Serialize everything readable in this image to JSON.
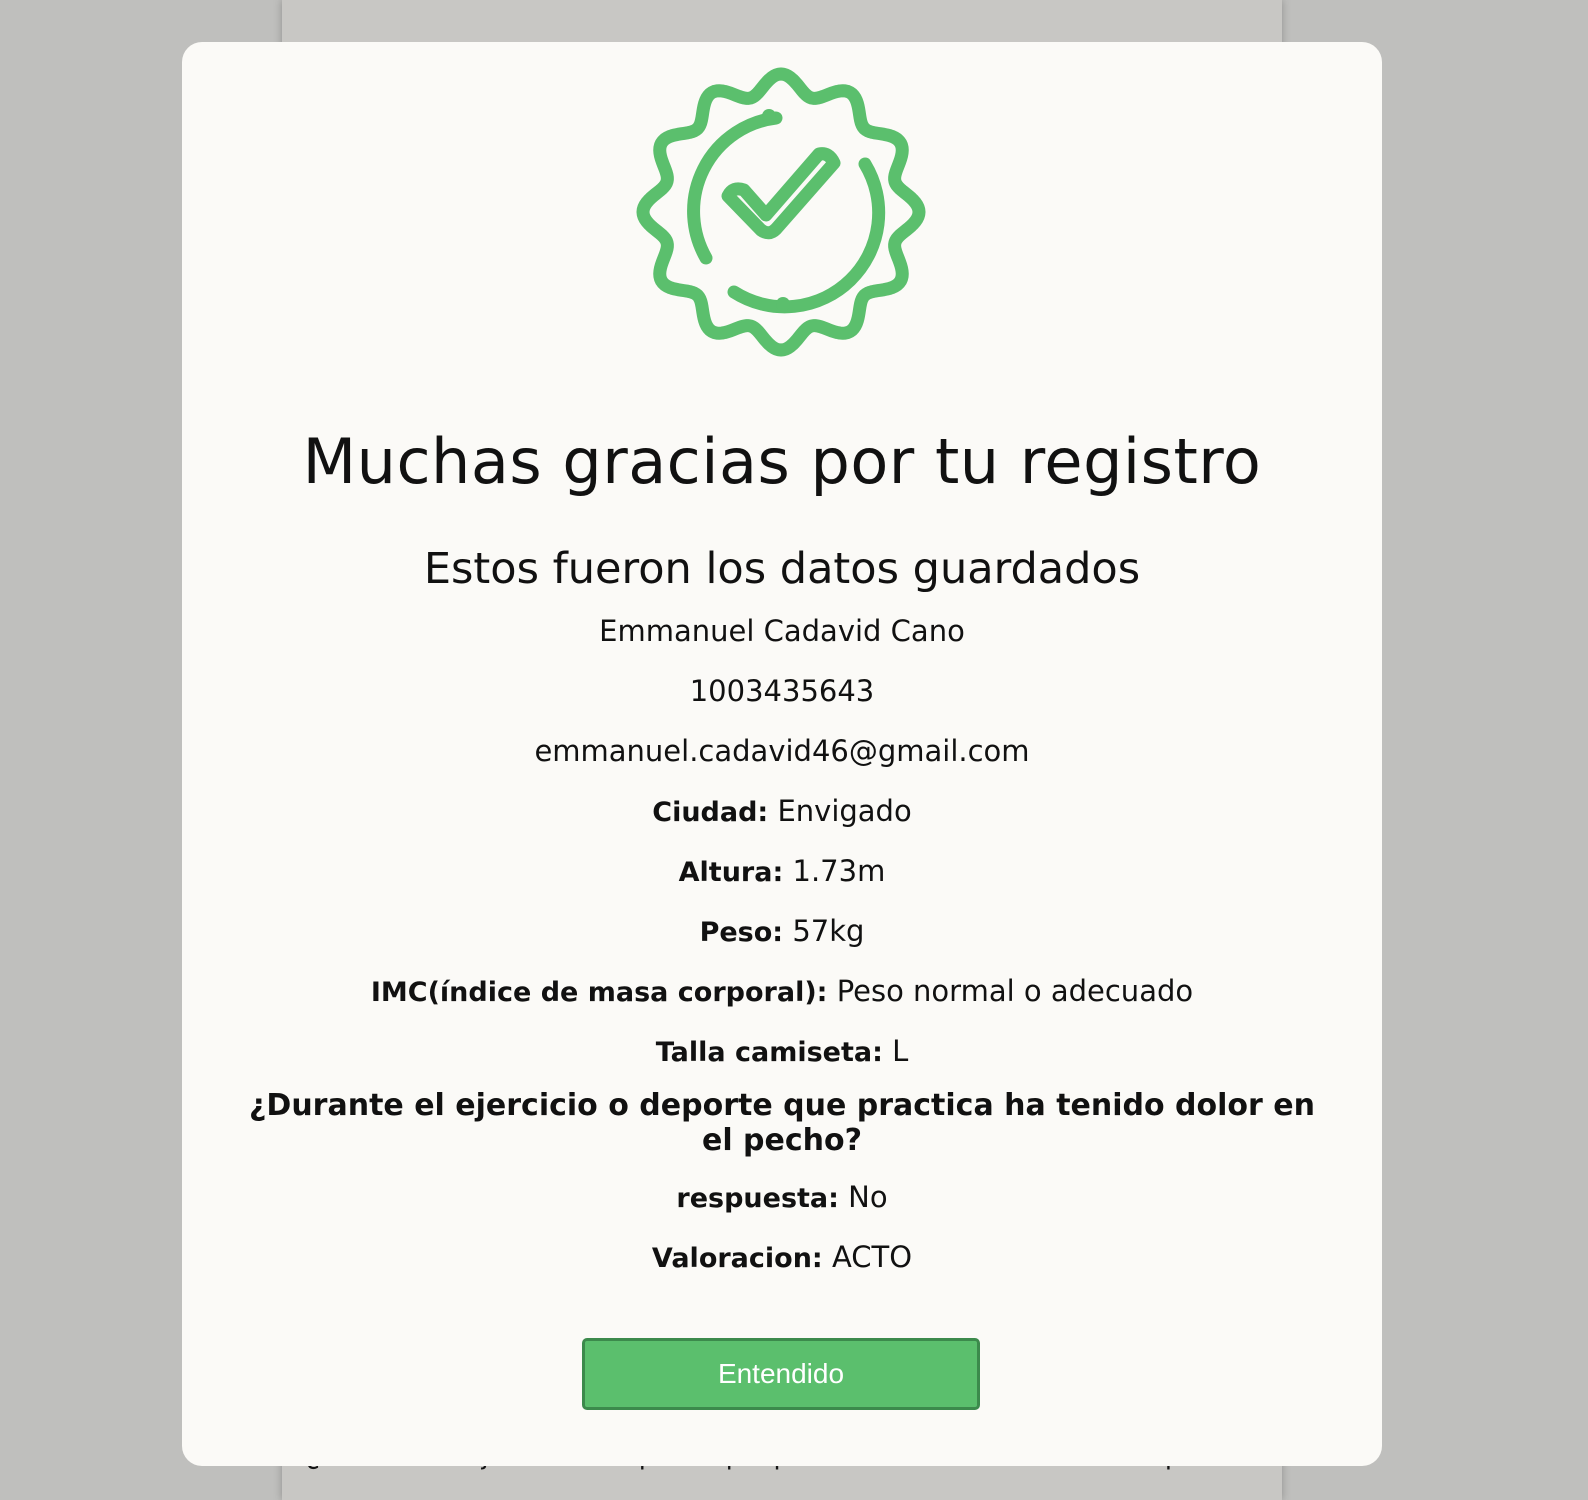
{
  "modal": {
    "title": "Muchas gracias por tu registro",
    "subtitle": "Estos fueron los datos guardados",
    "name": "Emmanuel Cadavid Cano",
    "document_id": "1003435643",
    "email": "emmanuel.cadavid46@gmail.com",
    "fields": [
      {
        "label": "Ciudad:",
        "value": "Envigado"
      },
      {
        "label": "Altura:",
        "value": "1.73m"
      },
      {
        "label": "Peso:",
        "value": "57kg"
      },
      {
        "label": "IMC(índice de masa corporal):",
        "value": "Peso normal o adecuado"
      },
      {
        "label": "Talla camiseta:",
        "value": "L"
      }
    ],
    "question": "¿Durante el ejercicio o deporte que practica ha tenido dolor en el pecho?",
    "answer": {
      "label": "respuesta:",
      "value": "No"
    },
    "rating": {
      "label": "Valoracion:",
      "value": "ACTO"
    },
    "button_label": "Entendido",
    "badge_icon": "check-badge-icon",
    "accent_color": "#5bbf6d"
  },
  "background": {
    "question": "¿Durante el ejercicio o deporte que practica ha tenido dolor en el pecho?"
  }
}
